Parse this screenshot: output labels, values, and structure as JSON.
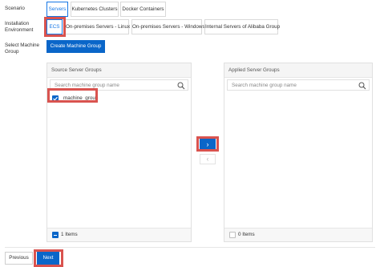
{
  "scenario": {
    "label": "Scenario",
    "options": [
      "Servers",
      "Kubernetes Clusters",
      "Docker Containers"
    ],
    "selected": "Servers"
  },
  "installation": {
    "label_line1": "Installation",
    "label_line2": "Environment",
    "options": [
      "ECS",
      "On-premises Servers - Linux",
      "On-premises Servers - Windows",
      "Internal Servers of Alibaba Group"
    ],
    "selected": "ECS"
  },
  "machine_group": {
    "label_line1": "Select Machine",
    "label_line2": "Group",
    "create_button": "Create Machine Group"
  },
  "source_panel": {
    "title": "Source Server Groups",
    "search_placeholder": "Search machine group name",
    "items": [
      {
        "label": "machine_group",
        "checked": true
      }
    ],
    "footer_count": "1 Items",
    "footer_checked": true
  },
  "applied_panel": {
    "title": "Applied Server Groups",
    "search_placeholder": "Search machine group name",
    "items": [],
    "footer_count": "0 Items",
    "footer_checked": false
  },
  "transfer": {
    "move_right": "›",
    "move_left": "‹"
  },
  "footer": {
    "previous": "Previous",
    "next": "Next"
  },
  "colors": {
    "primary": "#0a66c9",
    "highlight": "#d9534f",
    "selected_border": "#1677e5"
  }
}
